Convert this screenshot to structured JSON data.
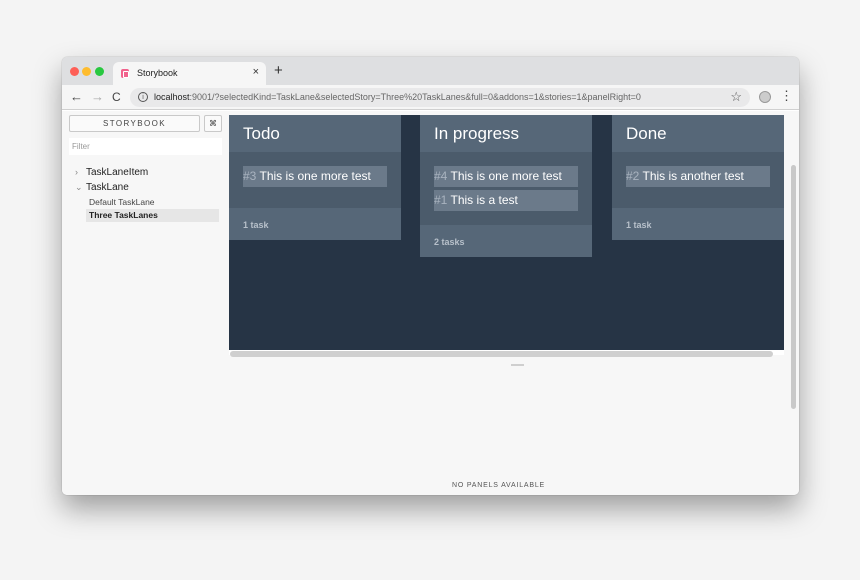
{
  "browser": {
    "tab_title": "Storybook",
    "tab_close": "×",
    "new_tab": "+",
    "nav_back": "←",
    "nav_forward": "→",
    "nav_reload": "C",
    "url_host": "localhost",
    "url_rest": ":9001/?selectedKind=TaskLane&selectedStory=Three%20TaskLanes&full=0&addons=1&stories=1&panelRight=0",
    "star": "☆",
    "menu": "⋮"
  },
  "sidebar": {
    "brand": "STORYBOOK",
    "shortcut_key": "⌘",
    "filter_placeholder": "Filter",
    "tree": [
      {
        "label": "TaskLaneItem",
        "chevron": "›"
      },
      {
        "label": "TaskLane",
        "chevron": "⌄"
      },
      {
        "label": "Default TaskLane"
      },
      {
        "label": "Three TaskLanes",
        "selected": true
      }
    ]
  },
  "board": {
    "lanes": [
      {
        "title": "Todo",
        "cards": [
          {
            "num": "#3",
            "text": "This is one more test"
          }
        ],
        "footer": "1 task"
      },
      {
        "title": "In progress",
        "cards": [
          {
            "num": "#4",
            "text": "This is one more test"
          },
          {
            "num": "#1",
            "text": "This is a test"
          }
        ],
        "footer": "2 tasks"
      },
      {
        "title": "Done",
        "cards": [
          {
            "num": "#2",
            "text": "This is another test"
          }
        ],
        "footer": "1 task"
      }
    ]
  },
  "addons": {
    "empty_message": "NO PANELS AVAILABLE"
  },
  "colors": {
    "board_bg": "#263445",
    "lane_bg": "#4b5b6b",
    "lane_head": "#566778",
    "card_bg": "#6b7a8a"
  }
}
